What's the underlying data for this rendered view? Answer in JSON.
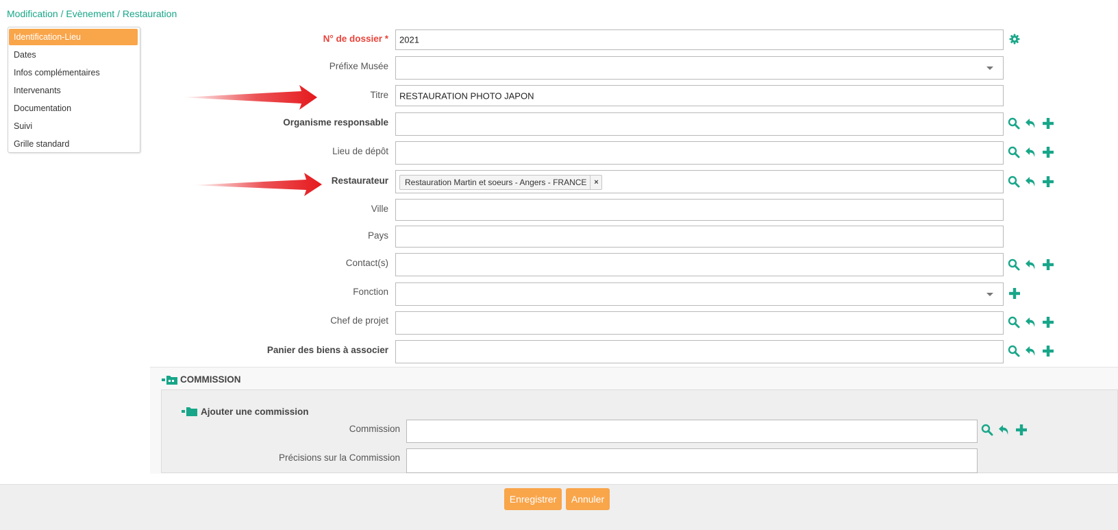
{
  "breadcrumb": "Modification / Evènement / Restauration",
  "sidebar": {
    "items": [
      {
        "label": "Identification-Lieu",
        "active": true
      },
      {
        "label": "Dates"
      },
      {
        "label": "Infos complémentaires"
      },
      {
        "label": "Intervenants"
      },
      {
        "label": "Documentation"
      },
      {
        "label": "Suivi"
      },
      {
        "label": "Grille standard"
      }
    ]
  },
  "form": {
    "dossier": {
      "label": "N° de dossier *",
      "value": "2021"
    },
    "prefixe": {
      "label": "Préfixe Musée",
      "value": ""
    },
    "titre": {
      "label": "Titre",
      "value": "RESTAURATION PHOTO JAPON"
    },
    "organisme": {
      "label": "Organisme responsable",
      "value": ""
    },
    "lieu": {
      "label": "Lieu de dépôt",
      "value": ""
    },
    "restaurateur": {
      "label": "Restaurateur",
      "tag": "Restauration Martin et soeurs - Angers - FRANCE",
      "remove": "×"
    },
    "ville": {
      "label": "Ville",
      "value": ""
    },
    "pays": {
      "label": "Pays",
      "value": ""
    },
    "contacts": {
      "label": "Contact(s)",
      "value": ""
    },
    "fonction": {
      "label": "Fonction",
      "value": ""
    },
    "chef": {
      "label": "Chef de projet",
      "value": ""
    },
    "panier": {
      "label": "Panier des biens à associer",
      "value": ""
    }
  },
  "commission": {
    "title": "COMMISSION",
    "add_title": "Ajouter une commission",
    "commission_label": "Commission",
    "precisions_label": "Précisions sur la Commission"
  },
  "footer": {
    "save": "Enregistrer",
    "cancel": "Annuler"
  },
  "colors": {
    "accent": "#18a689",
    "orange": "#f9a54a",
    "required": "#e8433a",
    "arrow": "#e5191d"
  },
  "icons": [
    "gear-icon",
    "search-icon",
    "undo-icon",
    "plus-icon",
    "folder-icon",
    "chevron-down-icon",
    "arrow-annotation"
  ]
}
